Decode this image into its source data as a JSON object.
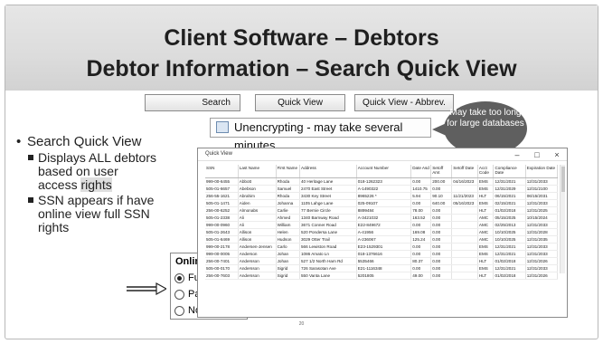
{
  "slide": {
    "title_line1": "Client Software – Debtors",
    "title_line2": "Debtor Information – Search Quick View",
    "page_number": "20"
  },
  "toolbar": {
    "search_label": "Search",
    "quick_view_label": "Quick View",
    "quick_view_abbrev_label": "Quick View - Abbrev."
  },
  "callout": {
    "text": "May take too long for large databases"
  },
  "status": {
    "unencrypting_text": "Unencrypting - may take several minutes ..."
  },
  "bullets": {
    "main": "Search Quick View",
    "sub1_a": "Displays ALL debtors based on user access ",
    "sub1_b": "rights",
    "sub2": "SSN appears if have online view full SSN rights"
  },
  "online_panel": {
    "heading": "Online",
    "options": [
      "Full SSN",
      "Partial SSN",
      "No SSN"
    ],
    "selected": "Full SSN"
  },
  "quick_view_window": {
    "title": "Quick View",
    "controls": [
      "–",
      "□",
      "×"
    ],
    "columns": [
      "SSN",
      "Last Name",
      "First Name",
      "Address",
      "Account Number",
      "Date Asd",
      "Setoff Amt",
      "Setoff Date",
      "Acct Code",
      "Compliance Date",
      "Expiration Date"
    ],
    "rows": [
      [
        "999-00-6455",
        "Abbott",
        "Rhoda",
        "40 Heritage Lane",
        "018-1262323",
        "0.00",
        "200.00",
        "04/16/2023",
        "EMS",
        "12/31/2021",
        "12/31/2033"
      ],
      [
        "505-01-6657",
        "Abebson",
        "Samuel",
        "2470 East Street",
        "A-1490322",
        "1410.75",
        "0.00",
        "",
        "EMS",
        "12/31/2029",
        "12/31/2100"
      ],
      [
        "256-55-1621",
        "Abrahim",
        "Rhoda",
        "3430 Key Street",
        "8965226 *",
        "5.94",
        "90.10",
        "11/21/2023",
        "HLT",
        "06/15/2021",
        "06/15/2031"
      ],
      [
        "505-01-1471",
        "Aiden",
        "Johanna",
        "1105 Lahge Lane",
        "025-09107",
        "0.00",
        "640.00",
        "05/16/2023",
        "EMS",
        "02/15/2021",
        "12/31/2033"
      ],
      [
        "256-00-6252",
        "Almonabs",
        "Carlie",
        "77 Bernie Circle",
        "8899484",
        "78.00",
        "0.00",
        "",
        "HLT",
        "01/02/2018",
        "12/31/2025"
      ],
      [
        "505-01-2338",
        "Ali",
        "Ahmed",
        "1340 Barnway Road",
        "A-3421032",
        "163.52",
        "0.00",
        "",
        "AMC",
        "05/15/2025",
        "10/15/2024"
      ],
      [
        "999-00-0960",
        "Ali",
        "William",
        "3671 Conner Road",
        "E22-849672",
        "0.00",
        "0.00",
        "",
        "AMC",
        "02/25/2013",
        "12/31/2033"
      ],
      [
        "505-01-2643",
        "Allison",
        "Helen",
        "520 Pondersa Lane",
        "A-41956",
        "169.08",
        "0.00",
        "",
        "AMC",
        "10/10/2025",
        "12/31/2028"
      ],
      [
        "505-01-6469",
        "Allison",
        "Hudson",
        "3029 Otter Trail",
        "A-236067",
        "125.24",
        "0.00",
        "",
        "AMC",
        "10/10/2025",
        "12/31/2035"
      ],
      [
        "999-00-2178",
        "Andersen-Jensen",
        "Carlo",
        "566 Lewiston Road",
        "E23-1529301",
        "0.00",
        "0.00",
        "",
        "EMS",
        "12/31/2021",
        "12/31/2033"
      ],
      [
        "999-00-0005",
        "Anderson",
        "Johan",
        "1086 Amato Ln",
        "018-1376616",
        "0.00",
        "0.00",
        "",
        "EMS",
        "12/31/2021",
        "12/31/2033"
      ],
      [
        "256-00-7401",
        "Andersson",
        "Johan",
        "527 1/2 North Ham Rd",
        "5535466",
        "80.37",
        "0.00",
        "",
        "HLT",
        "01/02/2018",
        "12/31/2026"
      ],
      [
        "505-00-0170",
        "Andersson",
        "Sigrid",
        "726 Sarasotan Ave",
        "E21-1116348",
        "0.00",
        "0.00",
        "",
        "EMS",
        "12/31/2021",
        "12/31/2033"
      ],
      [
        "256-00-7603",
        "Andersson",
        "Sigrid",
        "550 Vanta Lane",
        "5201805",
        "49.00",
        "0.00",
        "",
        "HLT",
        "01/02/2018",
        "12/31/2026"
      ]
    ]
  },
  "colors": {
    "callout_bg": "#5f5f5f",
    "title_band": "#dcdcdc"
  }
}
